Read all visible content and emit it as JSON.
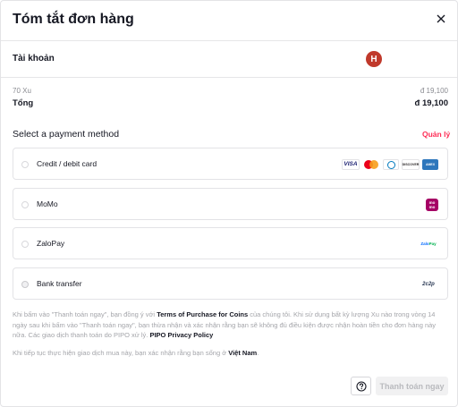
{
  "header": {
    "title": "Tóm tắt đơn hàng",
    "close_icon": "close-icon"
  },
  "account": {
    "label": "Tài khoản",
    "avatar_letter": "H",
    "avatar_color": "#c0392b"
  },
  "order": {
    "item_label": "70 Xu",
    "item_amount": "đ 19,100",
    "total_label": "Tổng",
    "total_amount": "đ 19,100"
  },
  "payment": {
    "title": "Select a payment method",
    "manage_label": "Quản lý",
    "methods": [
      {
        "label": "Credit / debit card",
        "logos": [
          "visa-logo",
          "mastercard-logo",
          "diners-logo",
          "discover-logo",
          "amex-logo"
        ],
        "logo_text": {
          "visa": "VISA",
          "discover": "DISCOVER",
          "amex": "AMEX"
        }
      },
      {
        "label": "MoMo",
        "logos": [
          "momo-logo"
        ],
        "logo_text": {
          "momo": "mo mo"
        }
      },
      {
        "label": "ZaloPay",
        "logos": [
          "zalopay-logo"
        ],
        "logo_text": {
          "zalo": "Zalo",
          "pay": "Pay"
        }
      },
      {
        "label": "Bank transfer",
        "logos": [
          "2c2p-logo"
        ],
        "logo_text": {
          "c2p": "2c2p"
        }
      }
    ]
  },
  "legal": {
    "p1_a": "Khi bấm vào \"Thanh toán ngay\", bạn đồng ý với ",
    "p1_link1": "Terms of Purchase for Coins",
    "p1_b": " của chúng tôi. Khi sử dụng bất kỳ lượng Xu nào trong vòng 14 ngày sau khi bấm vào \"Thanh toán ngay\", bạn thừa nhận và xác nhận rằng bạn sẽ không đủ điều kiện được nhận hoàn tiền cho đơn hàng này nữa. Các giao dịch thanh toán do PIPO xử lý. ",
    "p1_link2": "PIPO Privacy Policy",
    "p2_a": "Khi tiếp tục thực hiện giao dịch mua này, bạn xác nhận rằng bạn sống ở ",
    "p2_country": "Việt Nam",
    "p2_b": "."
  },
  "footer": {
    "help_icon": "question-circle-icon",
    "pay_label": "Thanh toán ngay"
  },
  "colors": {
    "accent": "#fe2c55",
    "disabled_bg": "#f1f1f2",
    "disabled_text": "#b9babe"
  }
}
